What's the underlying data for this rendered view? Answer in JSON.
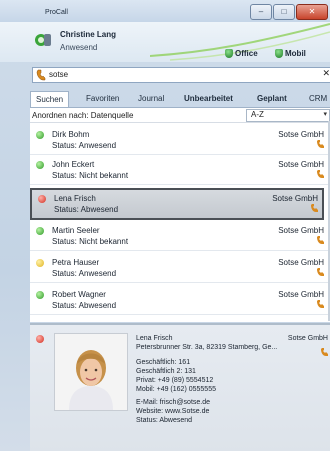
{
  "window": {
    "title": "ProCall",
    "controls": [
      "–",
      "□",
      "✕"
    ]
  },
  "user": {
    "name": "Christine Lang",
    "status": "Anwesend"
  },
  "locations": [
    {
      "label": "Office"
    },
    {
      "label": "Mobil"
    }
  ],
  "search": {
    "value": "sotse",
    "clear": "✕"
  },
  "tabs": [
    {
      "label": "Suchen"
    },
    {
      "label": "Favoriten"
    },
    {
      "label": "Journal"
    },
    {
      "label": "Unbearbeitet"
    },
    {
      "label": "Geplant"
    },
    {
      "label": "CRM"
    }
  ],
  "sort": {
    "label": "Anordnen nach: Datenquelle",
    "value": "A-Z",
    "arrow": "▾"
  },
  "contacts": [
    {
      "name": "Dirk Bohm",
      "status": "Status: Anwesend",
      "company": "Sotse GmbH",
      "dot": "green"
    },
    {
      "name": "John Eckert",
      "status": "Status: Nicht bekannt",
      "company": "Sotse GmbH",
      "dot": "green"
    },
    {
      "name": "Lena Frisch",
      "status": "Status: Abwesend",
      "company": "Sotse GmbH",
      "dot": "red"
    },
    {
      "name": "Martin Seeler",
      "status": "Status: Nicht bekannt",
      "company": "Sotse GmbH",
      "dot": "green"
    },
    {
      "name": "Petra Hauser",
      "status": "Status: Anwesend",
      "company": "Sotse GmbH",
      "dot": "yellow"
    },
    {
      "name": "Robert Wagner",
      "status": "Status: Abwesend",
      "company": "Sotse GmbH",
      "dot": "green"
    }
  ],
  "detail": {
    "name": "Lena Frisch",
    "company": "Sotse GmbH",
    "address": "Petersbrunner Str. 3a, 82319 Stamberg, Ge...",
    "business1": "Geschäftlich: 161",
    "business2": "Geschäftlich 2: 131",
    "private": "Privat: +49 (89) 5554512",
    "mobile": "Mobil: +49 (162) 0555555",
    "email": "E-Mail: frisch@sotse.de",
    "website": "Website: www.Sotse.de",
    "status": "Status: Abwesend"
  },
  "colors": {
    "green": "#2f9a27",
    "red": "#d22d20",
    "yellow": "#e0b320",
    "accent": "#9fb2c8"
  }
}
